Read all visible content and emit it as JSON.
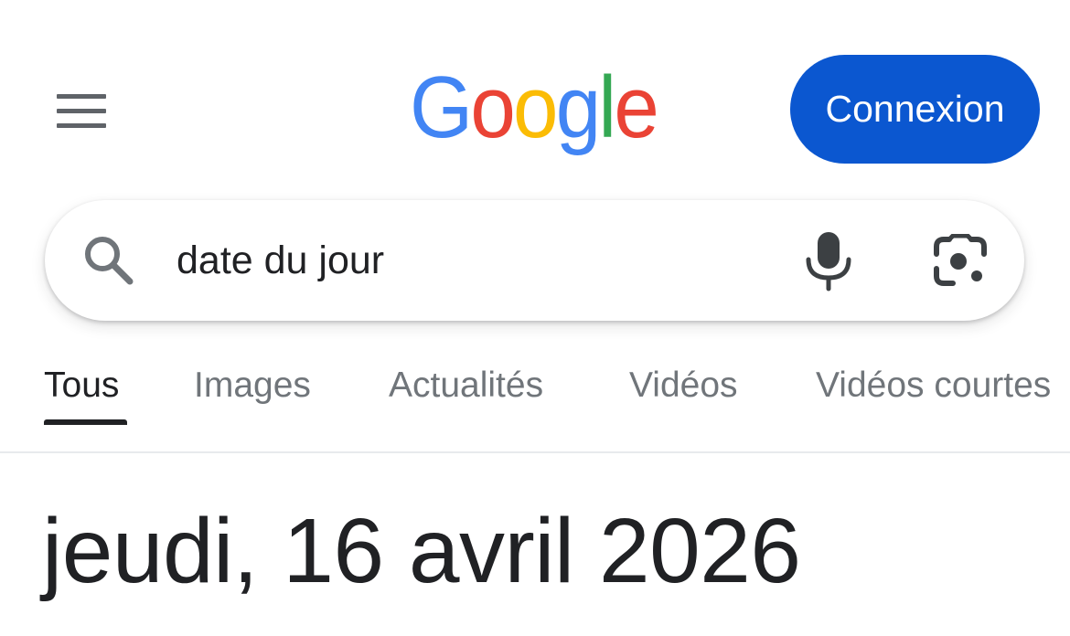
{
  "header": {
    "logo_text": "Google",
    "logo_letter_colors": [
      "#4285f4",
      "#ea4335",
      "#fbbc05",
      "#4285f4",
      "#34a853",
      "#ea4335"
    ],
    "signin_label": "Connexion",
    "signin_color": "#0b57d0"
  },
  "search": {
    "value": "date du jour",
    "icons": [
      "search-icon",
      "microphone-icon",
      "google-lens-icon"
    ]
  },
  "tabs": [
    {
      "label": "Tous",
      "active": true
    },
    {
      "label": "Images",
      "active": false
    },
    {
      "label": "Actualités",
      "active": false
    },
    {
      "label": "Vidéos",
      "active": false
    },
    {
      "label": "Vidéos courtes",
      "active": false
    }
  ],
  "result": {
    "date_text": "jeudi, 16 avril 2026"
  }
}
